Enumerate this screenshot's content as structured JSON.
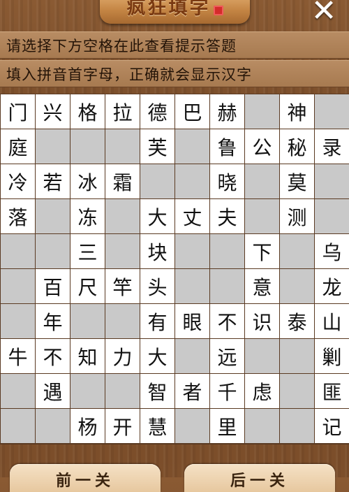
{
  "header": {
    "title": "疯狂填字",
    "close_label": "✕"
  },
  "hints": {
    "line1": "请选择下方空格在此查看提示答题",
    "line2": "填入拼音首字母，正确就会显示汉字"
  },
  "grid": [
    [
      "门",
      "兴",
      "格",
      "拉",
      "德",
      "巴",
      "赫",
      "",
      "神",
      ""
    ],
    [
      "庭",
      "",
      "",
      "",
      "芙",
      "",
      "鲁",
      "公",
      "秘",
      "录"
    ],
    [
      "冷",
      "若",
      "冰",
      "霜",
      "",
      "",
      "晓",
      "",
      "莫",
      ""
    ],
    [
      "落",
      "",
      "冻",
      "",
      "大",
      "丈",
      "夫",
      "",
      "测",
      ""
    ],
    [
      "",
      "",
      "三",
      "",
      "块",
      "",
      "",
      "下",
      "",
      "乌"
    ],
    [
      "",
      "百",
      "尺",
      "竿",
      "头",
      "",
      "",
      "意",
      "",
      "龙"
    ],
    [
      "",
      "年",
      "",
      "",
      "有",
      "眼",
      "不",
      "识",
      "泰",
      "山"
    ],
    [
      "牛",
      "不",
      "知",
      "力",
      "大",
      "",
      "远",
      "",
      "",
      "剿"
    ],
    [
      "",
      "遇",
      "",
      "",
      "智",
      "者",
      "千",
      "虑",
      "",
      "匪"
    ],
    [
      "",
      "",
      "杨",
      "开",
      "慧",
      "",
      "里",
      "",
      "",
      "记"
    ]
  ],
  "filled": [
    [
      1,
      1,
      1,
      1,
      1,
      1,
      1,
      0,
      1,
      0
    ],
    [
      1,
      0,
      0,
      0,
      1,
      0,
      1,
      1,
      1,
      1
    ],
    [
      1,
      1,
      1,
      1,
      0,
      0,
      1,
      0,
      1,
      0
    ],
    [
      1,
      0,
      1,
      0,
      1,
      1,
      1,
      0,
      1,
      0
    ],
    [
      0,
      0,
      1,
      0,
      1,
      0,
      0,
      1,
      0,
      1
    ],
    [
      0,
      1,
      1,
      1,
      1,
      0,
      0,
      1,
      0,
      1
    ],
    [
      0,
      1,
      0,
      0,
      1,
      1,
      1,
      1,
      1,
      1
    ],
    [
      1,
      1,
      1,
      1,
      1,
      0,
      1,
      0,
      0,
      1
    ],
    [
      0,
      1,
      0,
      0,
      1,
      1,
      1,
      1,
      0,
      1
    ],
    [
      0,
      0,
      1,
      1,
      1,
      0,
      1,
      0,
      0,
      1
    ]
  ],
  "footer": {
    "prev_label": "前一关",
    "next_label": "后一关"
  }
}
